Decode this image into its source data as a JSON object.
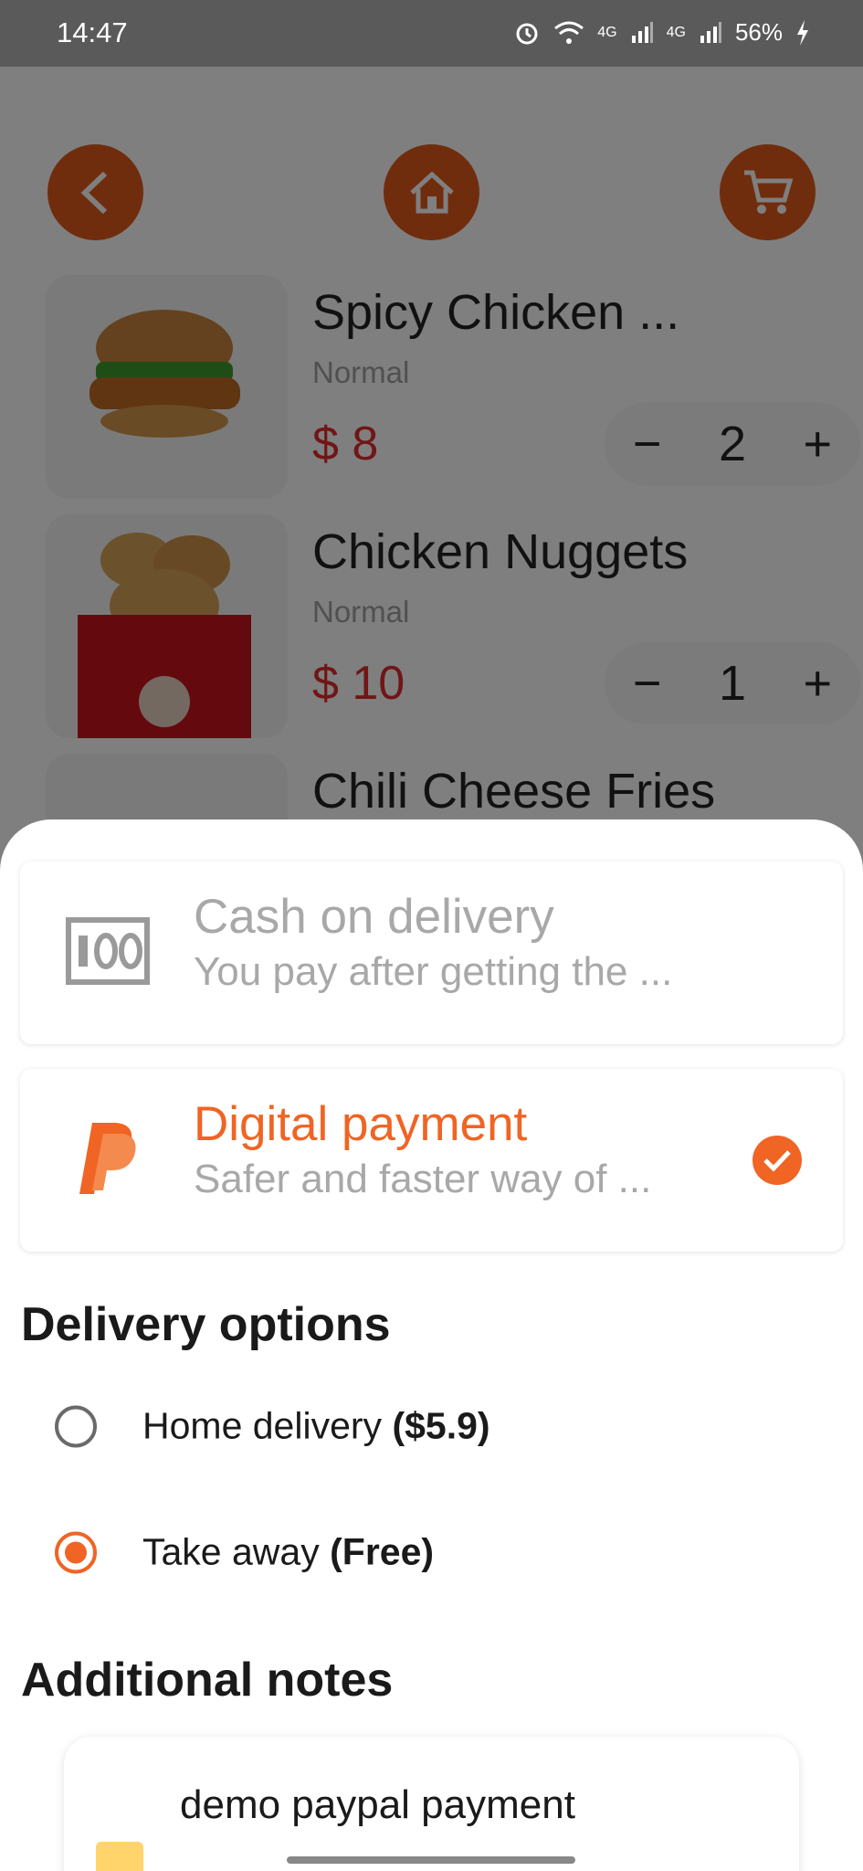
{
  "status_bar": {
    "time": "14:47",
    "battery": "56%",
    "network_1": "4G",
    "network_2": "4G"
  },
  "top_nav": {
    "back_icon": "chevron-left-icon",
    "home_icon": "home-icon",
    "cart_icon": "cart-icon",
    "accent_color": "#e05a1b"
  },
  "cart_items": [
    {
      "name": "Spicy Chicken ...",
      "variant": "Normal",
      "price": "$ 8",
      "quantity": "2"
    },
    {
      "name": "Chicken Nuggets",
      "variant": "Normal",
      "price": "$ 10",
      "quantity": "1"
    },
    {
      "name": "Chili Cheese Fries"
    }
  ],
  "qty_controls": {
    "minus": "−",
    "plus": "+"
  },
  "payment_methods": [
    {
      "title": "Cash on delivery",
      "subtitle": "You pay after getting the ...",
      "icon": "cash-icon",
      "selected": false
    },
    {
      "title": "Digital payment",
      "subtitle": "Safer and faster way of ...",
      "icon": "paypal-icon",
      "selected": true
    }
  ],
  "delivery": {
    "title": "Delivery options",
    "options": [
      {
        "label": "Home delivery",
        "price": "($5.9)",
        "selected": false
      },
      {
        "label": "Take away",
        "price": "(Free)",
        "selected": true
      }
    ]
  },
  "notes": {
    "title": "Additional notes",
    "value": "demo paypal payment"
  },
  "colors": {
    "primary": "#f06424",
    "price": "#e02d2d"
  }
}
